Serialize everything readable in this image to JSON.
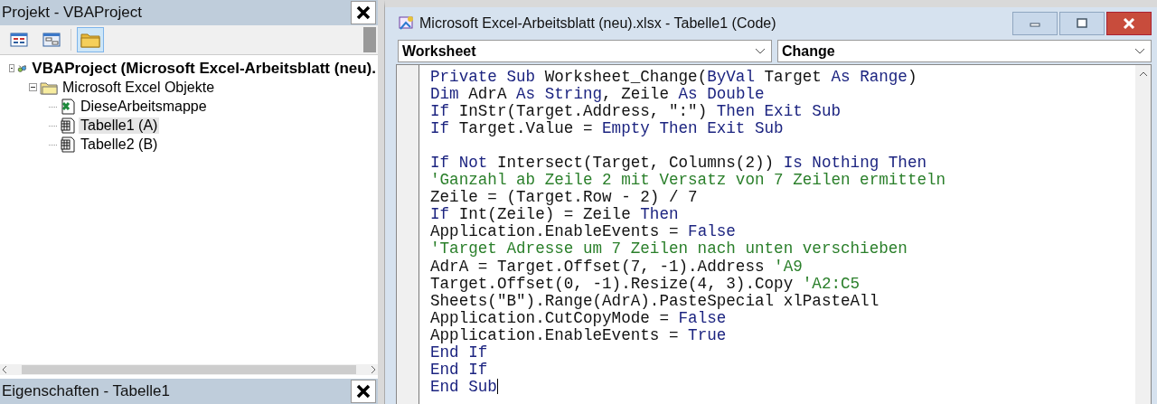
{
  "project_panel": {
    "title": "Projekt - VBAProject",
    "toolbar": [
      {
        "kind": "view-code",
        "selected": false
      },
      {
        "kind": "view-object",
        "selected": false
      },
      {
        "kind": "folders",
        "selected": true
      }
    ],
    "tree": [
      {
        "label": "VBAProject (Microsoft Excel-Arbeitsblatt (neu).",
        "kind": "project",
        "bold": true,
        "expanded": true,
        "selected": false,
        "children": [
          {
            "label": "Microsoft Excel Objekte",
            "kind": "folder",
            "bold": false,
            "expanded": true,
            "selected": false,
            "children": [
              {
                "label": "DieseArbeitsmappe",
                "kind": "workbook",
                "bold": false,
                "selected": false
              },
              {
                "label": "Tabelle1 (A)",
                "kind": "sheet",
                "bold": false,
                "selected": true
              },
              {
                "label": "Tabelle2 (B)",
                "kind": "sheet",
                "bold": false,
                "selected": false
              }
            ]
          }
        ]
      }
    ]
  },
  "properties_panel": {
    "title": "Eigenschaften - Tabelle1"
  },
  "code_window": {
    "title": "Microsoft Excel-Arbeitsblatt (neu).xlsx - Tabelle1 (Code)",
    "object_dropdown": "Worksheet",
    "procedure_dropdown": "Change",
    "lines": [
      {
        "kind": "code",
        "segments": [
          {
            "text": "Private Sub",
            "kind": "keyword"
          },
          {
            "text": " Worksheet_Change(",
            "kind": "plain"
          },
          {
            "text": "ByVal",
            "kind": "keyword"
          },
          {
            "text": " Target ",
            "kind": "plain"
          },
          {
            "text": "As Range",
            "kind": "keyword"
          },
          {
            "text": ")",
            "kind": "plain"
          }
        ]
      },
      {
        "kind": "code",
        "segments": [
          {
            "text": "Dim",
            "kind": "keyword"
          },
          {
            "text": " AdrA ",
            "kind": "plain"
          },
          {
            "text": "As String",
            "kind": "keyword"
          },
          {
            "text": ", Zeile ",
            "kind": "plain"
          },
          {
            "text": "As Double",
            "kind": "keyword"
          }
        ]
      },
      {
        "kind": "code",
        "segments": [
          {
            "text": "If",
            "kind": "keyword"
          },
          {
            "text": " InStr(Target.Address, \":\") ",
            "kind": "plain"
          },
          {
            "text": "Then Exit Sub",
            "kind": "keyword"
          }
        ]
      },
      {
        "kind": "code",
        "segments": [
          {
            "text": "If",
            "kind": "keyword"
          },
          {
            "text": " Target.Value = ",
            "kind": "plain"
          },
          {
            "text": "Empty Then Exit Sub",
            "kind": "keyword"
          }
        ]
      },
      {
        "kind": "blank"
      },
      {
        "kind": "code",
        "segments": [
          {
            "text": "If Not",
            "kind": "keyword"
          },
          {
            "text": " Intersect(Target, Columns(2)) ",
            "kind": "plain"
          },
          {
            "text": "Is Nothing Then",
            "kind": "keyword"
          }
        ]
      },
      {
        "kind": "code",
        "segments": [
          {
            "text": "'Ganzahl ab Zeile 2 mit Versatz von 7 Zeilen ermitteln",
            "kind": "comment"
          }
        ]
      },
      {
        "kind": "code",
        "segments": [
          {
            "text": "Zeile = (Target.Row - 2) / 7",
            "kind": "plain"
          }
        ]
      },
      {
        "kind": "code",
        "segments": [
          {
            "text": "If",
            "kind": "keyword"
          },
          {
            "text": " Int(Zeile) = Zeile ",
            "kind": "plain"
          },
          {
            "text": "Then",
            "kind": "keyword"
          }
        ]
      },
      {
        "kind": "code",
        "segments": [
          {
            "text": "Application.EnableEvents = ",
            "kind": "plain"
          },
          {
            "text": "False",
            "kind": "keyword"
          }
        ]
      },
      {
        "kind": "code",
        "segments": [
          {
            "text": "'Target Adresse um 7 Zeilen nach unten verschieben",
            "kind": "comment"
          }
        ]
      },
      {
        "kind": "code",
        "segments": [
          {
            "text": "AdrA = Target.Offset(7, -1).Address ",
            "kind": "plain"
          },
          {
            "text": "'A9",
            "kind": "comment"
          }
        ]
      },
      {
        "kind": "code",
        "segments": [
          {
            "text": "Target.Offset(0, -1).Resize(4, 3).Copy ",
            "kind": "plain"
          },
          {
            "text": "'A2:C5",
            "kind": "comment"
          }
        ]
      },
      {
        "kind": "code",
        "segments": [
          {
            "text": "Sheets(\"B\").Range(AdrA).PasteSpecial xlPasteAll",
            "kind": "plain"
          }
        ]
      },
      {
        "kind": "code",
        "segments": [
          {
            "text": "Application.CutCopyMode = ",
            "kind": "plain"
          },
          {
            "text": "False",
            "kind": "keyword"
          }
        ]
      },
      {
        "kind": "code",
        "segments": [
          {
            "text": "Application.EnableEvents = ",
            "kind": "plain"
          },
          {
            "text": "True",
            "kind": "keyword"
          }
        ]
      },
      {
        "kind": "code",
        "segments": [
          {
            "text": "End If",
            "kind": "keyword"
          }
        ]
      },
      {
        "kind": "code",
        "segments": [
          {
            "text": "End If",
            "kind": "keyword"
          }
        ]
      },
      {
        "kind": "code",
        "segments": [
          {
            "text": "End Sub",
            "kind": "keyword"
          }
        ],
        "cursor": true
      }
    ]
  }
}
